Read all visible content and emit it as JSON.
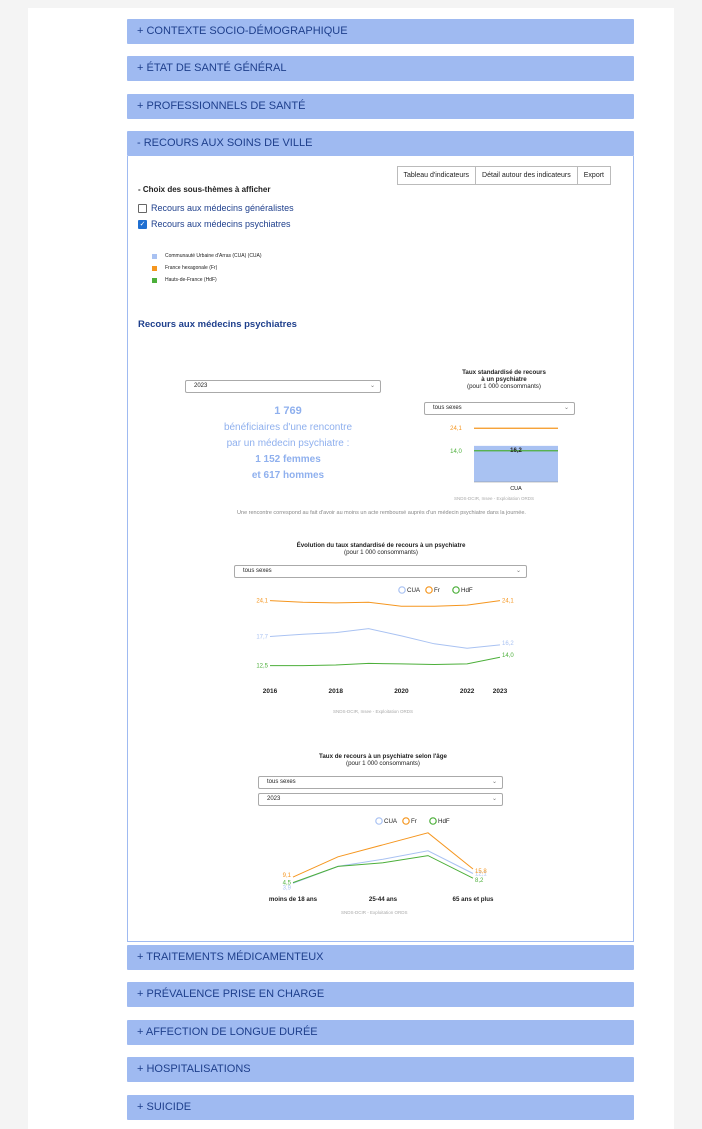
{
  "sections_top": [
    "+ CONTEXTE SOCIO-DÉMOGRAPHIQUE",
    "+ ÉTAT DE SANTÉ GÉNÉRAL",
    "+ PROFESSIONNELS DE SANTÉ"
  ],
  "open_section": "- RECOURS AUX SOINS DE VILLE",
  "sections_bottom": [
    "+ TRAITEMENTS MÉDICAMENTEUX",
    "+ PRÉVALENCE PRISE EN CHARGE",
    "+ AFFECTION DE LONGUE DURÉE",
    "+ HOSPITALISATIONS",
    "+ SUICIDE"
  ],
  "toolbar": {
    "table": "Tableau d'indicateurs",
    "detail": "Détail autour des indicateurs",
    "export": "Export"
  },
  "choice": {
    "title": "- Choix des sous-thèmes à afficher",
    "options": [
      {
        "label": "Recours aux médecins généralistes",
        "checked": false
      },
      {
        "label": "Recours aux médecins psychiatres",
        "checked": true
      }
    ]
  },
  "legend": [
    {
      "label": "Communauté Urbaine d'Arras (CUA) (CUA)",
      "color": "#a9c2f2"
    },
    {
      "label": "France hexagonale (Fr)",
      "color": "#f5961f"
    },
    {
      "label": "Hauts-de-France (HdF)",
      "color": "#4caf3a"
    }
  ],
  "subtheme_title": "Recours aux médecins psychiatres",
  "kpi": {
    "year_select": "2023",
    "count": "1 769",
    "line1": "bénéficiaires d'une rencontre",
    "line2": "par un médecin psychiatre :",
    "women": "1 152 femmes",
    "men": "et 617 hommes"
  },
  "rate_chart": {
    "title1": "Taux standardisé de recours",
    "title2": "à un psychiatre",
    "subtitle": "(pour 1 000 consommants)",
    "sex_select": "tous sexes",
    "source": "SNDS-DCIR, Insee - Exploitation ORDS"
  },
  "note": "Une rencontre correspond au fait d'avoir au moins un acte remboursé auprès d'un médecin psychiatre dans la journée.",
  "evolution_chart": {
    "title": "Évolution du taux standardisé de recours à un psychiatre",
    "subtitle": "(pour 1 000 consommants)",
    "sex_select": "tous sexes",
    "source": "SNDS-DCIR, Insee - Exploitation ORDS"
  },
  "age_chart": {
    "title": "Taux de recours à un psychiatre selon l'âge",
    "subtitle": "(pour 1 000 consommants)",
    "sex_select": "tous sexes",
    "year_select": "2023",
    "source": "SNDS-DCIR - Exploitation ORDS"
  },
  "chart_data": [
    {
      "type": "bar",
      "categories": [
        "CUA"
      ],
      "series": [
        {
          "name": "CUA",
          "values": [
            16.2
          ],
          "color": "#a9c2f2"
        },
        {
          "name": "Fr",
          "values": [
            24.1
          ],
          "color": "#f5961f"
        },
        {
          "name": "HdF",
          "values": [
            14.0
          ],
          "color": "#4caf3a"
        }
      ],
      "labels": {
        "cua": "16,2",
        "fr": "24,1",
        "hdf": "14,0"
      },
      "ylim": [
        0,
        26
      ]
    },
    {
      "type": "line",
      "x": [
        2016,
        2017,
        2018,
        2019,
        2020,
        2021,
        2022,
        2023
      ],
      "x_ticks": [
        "2016",
        "2018",
        "2020",
        "2022",
        "2023"
      ],
      "series": [
        {
          "name": "CUA",
          "values": [
            17.7,
            18.1,
            18.4,
            19.1,
            17.8,
            16.4,
            15.6,
            16.2
          ],
          "color": "#a9c2f2"
        },
        {
          "name": "Fr",
          "values": [
            24.1,
            23.8,
            23.7,
            23.8,
            23.1,
            23.1,
            23.3,
            24.1
          ],
          "color": "#f5961f"
        },
        {
          "name": "HdF",
          "values": [
            12.5,
            12.5,
            12.6,
            12.9,
            12.8,
            12.7,
            12.8,
            14.0
          ],
          "color": "#4caf3a"
        }
      ],
      "labels": {
        "cua_first": "17,7",
        "cua_last": "16,2",
        "fr_first": "24,1",
        "fr_last": "24,1",
        "hdf_first": "12,5",
        "hdf_last": "14,0"
      },
      "legend": [
        "CUA",
        "Fr",
        "HdF"
      ],
      "ylim": [
        11,
        26
      ]
    },
    {
      "type": "line",
      "categories": [
        "moins de 18 ans",
        "18-24 ans",
        "25-44 ans",
        "45-64 ans",
        "65 ans et plus"
      ],
      "x_ticks": [
        "moins de 18 ans",
        "25-44 ans",
        "65 ans et plus"
      ],
      "series": [
        {
          "name": "CUA",
          "values": [
            3.9,
            18.0,
            24.0,
            31.0,
            12.1
          ],
          "color": "#a9c2f2"
        },
        {
          "name": "Fr",
          "values": [
            9.1,
            26.0,
            36.0,
            46.0,
            15.8
          ],
          "color": "#f5961f"
        },
        {
          "name": "HdF",
          "values": [
            4.5,
            18.0,
            21.0,
            27.0,
            8.2
          ],
          "color": "#4caf3a"
        }
      ],
      "labels": {
        "cua_first": "3,9",
        "cua_last": "12,1",
        "fr_first": "9,1",
        "fr_last": "15,8",
        "hdf_first": "4,5",
        "hdf_last": "8,2"
      },
      "legend": [
        "CUA",
        "Fr",
        "HdF"
      ],
      "ylim": [
        0,
        50
      ]
    }
  ]
}
